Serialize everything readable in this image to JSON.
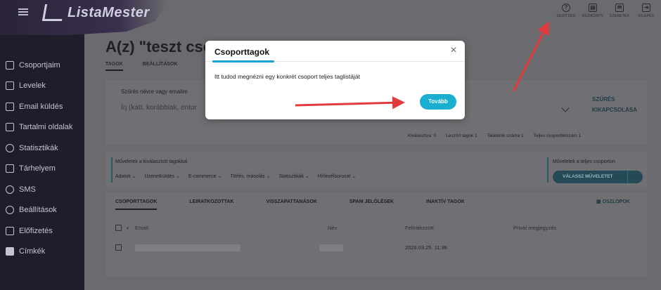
{
  "app": {
    "name": "ListaMester"
  },
  "sidebar": {
    "items": [
      {
        "label": "Csoportjaim",
        "icon": "clipboard-icon"
      },
      {
        "label": "Levelek",
        "icon": "envelope-icon"
      },
      {
        "label": "Email küldés",
        "icon": "pen-icon"
      },
      {
        "label": "Tartalmi oldalak",
        "icon": "book-icon"
      },
      {
        "label": "Statisztikák",
        "icon": "pie-chart-icon"
      },
      {
        "label": "Tárhelyem",
        "icon": "storage-icon"
      },
      {
        "label": "SMS",
        "icon": "sms-icon"
      },
      {
        "label": "Beállítások",
        "icon": "gear-icon"
      },
      {
        "label": "Előfizetés",
        "icon": "card-icon"
      },
      {
        "label": "Címkék",
        "icon": "tag-icon"
      }
    ]
  },
  "topbar": {
    "items": [
      {
        "label": "SEGÍTSÉG",
        "icon": "?"
      },
      {
        "label": "KÉZIKÖNYV",
        "icon": "▤"
      },
      {
        "label": "ÜZENETEK",
        "icon": "✉"
      },
      {
        "label": "KILÉPÉS",
        "icon": "⇥"
      }
    ]
  },
  "page": {
    "title": "A(z) \"teszt csop",
    "tabs": [
      "TAGOK",
      "BEÁLLÍTÁSOK"
    ]
  },
  "filter": {
    "label": "Szűrés névre vagy emailre",
    "placeholder": "Írj (katt. korábbiak, entor",
    "off_label_1": "SZŰRÉS",
    "off_label_2": "KIKAPCSOLÁSA",
    "stats": [
      "Kiválasztva: 0",
      "Leszűrt tagok 1",
      "Találatok száma 1",
      "Teljes csoportlétszám 1"
    ]
  },
  "actions": {
    "title": "Műveletek a kiválasztott tagokkal",
    "menu": [
      "Adatok",
      "Üzenetküldés",
      "E-commerce",
      "Törlés, másolás",
      "Statisztikák",
      "Hírlevélsorozat"
    ],
    "all_title": "Műveletek a teljes csoporton",
    "all_button": "VÁLASSZ MŰVELETET"
  },
  "table": {
    "tabs": [
      "CSOPORTTAGOK",
      "LEIRATKOZOTTAK",
      "VISSZAPATTANÁSOK",
      "SPAM JELÖLÉSEK",
      "INAKTÍV TAGOK"
    ],
    "columns_button": "OSZLOPOK",
    "headers": [
      "Email",
      "Név",
      "Feliratkozott",
      "Privát megjegyzés"
    ],
    "rows": [
      {
        "date": "2026.03.25. 11:36"
      }
    ]
  },
  "modal": {
    "title": "Csoporttagok",
    "text": "Itt tudod megnézni egy konkrét csoport teljes taglistáját",
    "button": "Tovább",
    "close_glyph": "×"
  },
  "colors": {
    "accent": "#1ca3d9",
    "button": "#1aaed0",
    "arrow": "#e03a3a",
    "sidebar": "#1d1d2b"
  }
}
